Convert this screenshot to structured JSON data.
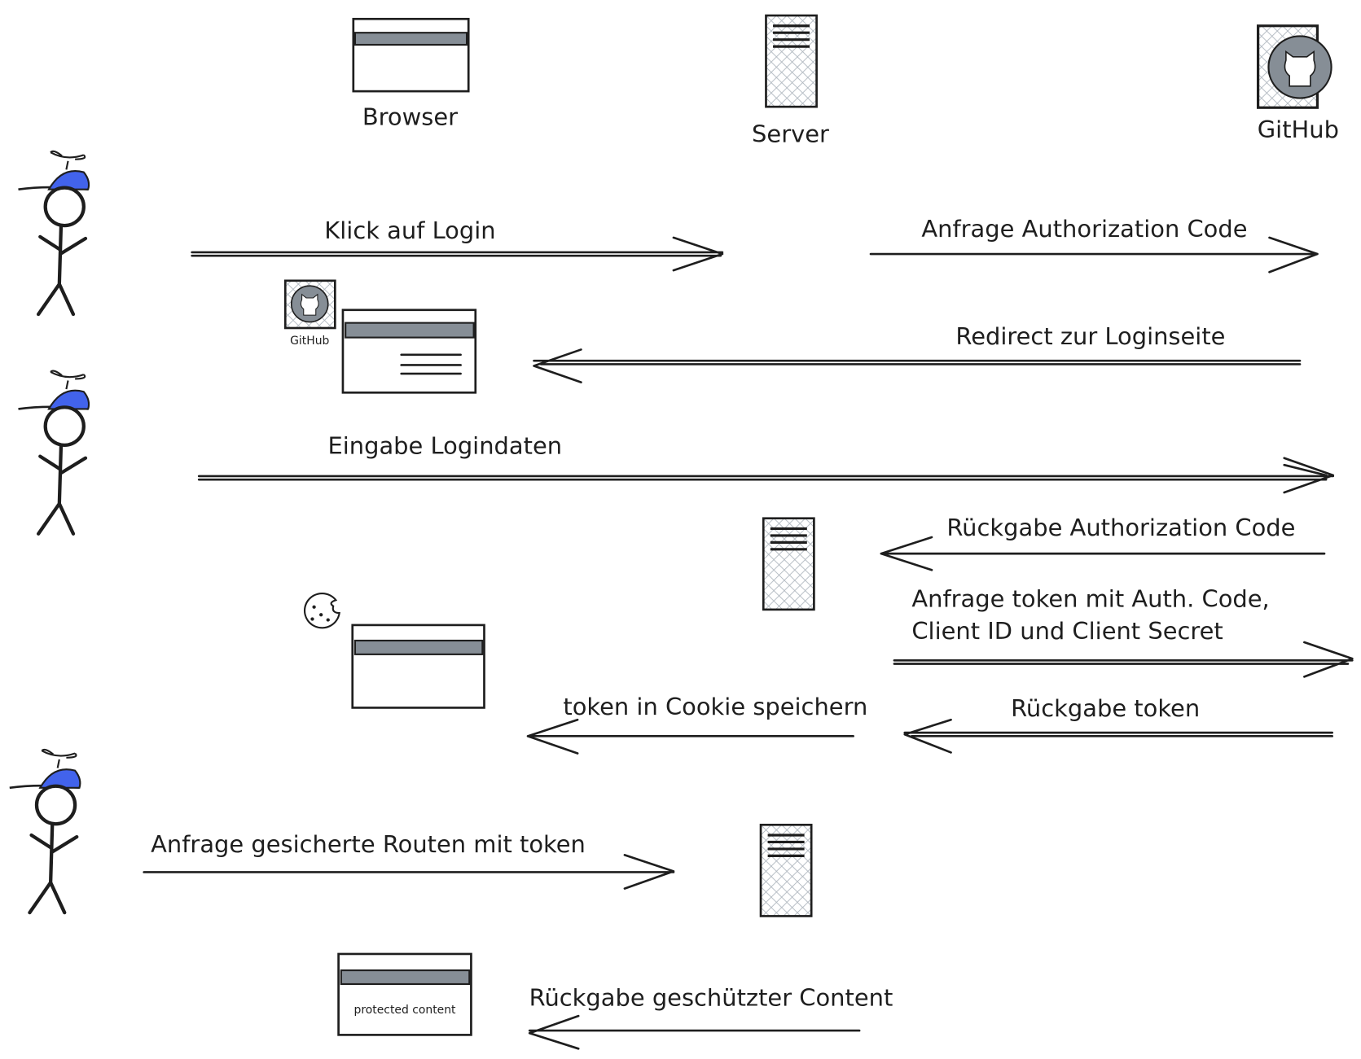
{
  "participants": {
    "browser": "Browser",
    "server": "Server",
    "github": "GitHub"
  },
  "colors": {
    "stroke": "#1e1e1e",
    "cap": "#4263eb",
    "gray": "#868e96"
  },
  "login_page": {
    "github_label": "GitHub"
  },
  "protected_page": {
    "content": "protected content"
  },
  "messages": [
    {
      "label": "Klick auf Login",
      "direction": "right"
    },
    {
      "label": "Anfrage Authorization Code",
      "direction": "right"
    },
    {
      "label": "Redirect zur Loginseite",
      "direction": "left"
    },
    {
      "label": "Eingabe Logindaten",
      "direction": "right"
    },
    {
      "label": "Rückgabe Authorization Code",
      "direction": "left"
    },
    {
      "label": "Anfrage token mit Auth. Code,",
      "label2": "Client ID und Client Secret",
      "direction": "right"
    },
    {
      "label": "token in Cookie speichern",
      "direction": "left"
    },
    {
      "label": "Rückgabe token",
      "direction": "left"
    },
    {
      "label": "Anfrage gesicherte Routen mit token",
      "direction": "right"
    },
    {
      "label": "Rückgabe geschützter Content",
      "direction": "left"
    }
  ]
}
